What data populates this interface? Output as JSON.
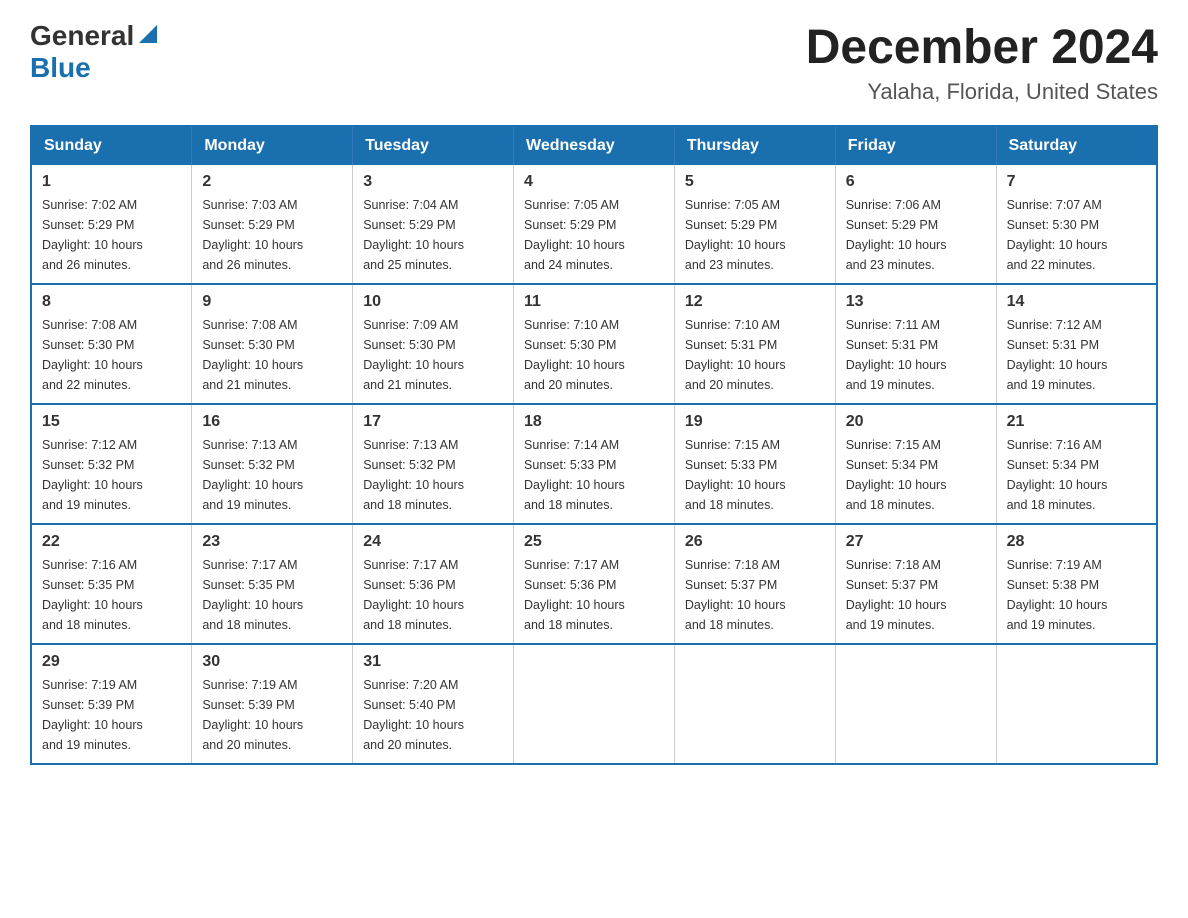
{
  "header": {
    "logo": {
      "general": "General",
      "blue": "Blue"
    },
    "month": "December 2024",
    "location": "Yalaha, Florida, United States"
  },
  "days_of_week": [
    "Sunday",
    "Monday",
    "Tuesday",
    "Wednesday",
    "Thursday",
    "Friday",
    "Saturday"
  ],
  "weeks": [
    [
      {
        "day": "1",
        "sunrise": "7:02 AM",
        "sunset": "5:29 PM",
        "daylight": "10 hours and 26 minutes."
      },
      {
        "day": "2",
        "sunrise": "7:03 AM",
        "sunset": "5:29 PM",
        "daylight": "10 hours and 26 minutes."
      },
      {
        "day": "3",
        "sunrise": "7:04 AM",
        "sunset": "5:29 PM",
        "daylight": "10 hours and 25 minutes."
      },
      {
        "day": "4",
        "sunrise": "7:05 AM",
        "sunset": "5:29 PM",
        "daylight": "10 hours and 24 minutes."
      },
      {
        "day": "5",
        "sunrise": "7:05 AM",
        "sunset": "5:29 PM",
        "daylight": "10 hours and 23 minutes."
      },
      {
        "day": "6",
        "sunrise": "7:06 AM",
        "sunset": "5:29 PM",
        "daylight": "10 hours and 23 minutes."
      },
      {
        "day": "7",
        "sunrise": "7:07 AM",
        "sunset": "5:30 PM",
        "daylight": "10 hours and 22 minutes."
      }
    ],
    [
      {
        "day": "8",
        "sunrise": "7:08 AM",
        "sunset": "5:30 PM",
        "daylight": "10 hours and 22 minutes."
      },
      {
        "day": "9",
        "sunrise": "7:08 AM",
        "sunset": "5:30 PM",
        "daylight": "10 hours and 21 minutes."
      },
      {
        "day": "10",
        "sunrise": "7:09 AM",
        "sunset": "5:30 PM",
        "daylight": "10 hours and 21 minutes."
      },
      {
        "day": "11",
        "sunrise": "7:10 AM",
        "sunset": "5:30 PM",
        "daylight": "10 hours and 20 minutes."
      },
      {
        "day": "12",
        "sunrise": "7:10 AM",
        "sunset": "5:31 PM",
        "daylight": "10 hours and 20 minutes."
      },
      {
        "day": "13",
        "sunrise": "7:11 AM",
        "sunset": "5:31 PM",
        "daylight": "10 hours and 19 minutes."
      },
      {
        "day": "14",
        "sunrise": "7:12 AM",
        "sunset": "5:31 PM",
        "daylight": "10 hours and 19 minutes."
      }
    ],
    [
      {
        "day": "15",
        "sunrise": "7:12 AM",
        "sunset": "5:32 PM",
        "daylight": "10 hours and 19 minutes."
      },
      {
        "day": "16",
        "sunrise": "7:13 AM",
        "sunset": "5:32 PM",
        "daylight": "10 hours and 19 minutes."
      },
      {
        "day": "17",
        "sunrise": "7:13 AM",
        "sunset": "5:32 PM",
        "daylight": "10 hours and 18 minutes."
      },
      {
        "day": "18",
        "sunrise": "7:14 AM",
        "sunset": "5:33 PM",
        "daylight": "10 hours and 18 minutes."
      },
      {
        "day": "19",
        "sunrise": "7:15 AM",
        "sunset": "5:33 PM",
        "daylight": "10 hours and 18 minutes."
      },
      {
        "day": "20",
        "sunrise": "7:15 AM",
        "sunset": "5:34 PM",
        "daylight": "10 hours and 18 minutes."
      },
      {
        "day": "21",
        "sunrise": "7:16 AM",
        "sunset": "5:34 PM",
        "daylight": "10 hours and 18 minutes."
      }
    ],
    [
      {
        "day": "22",
        "sunrise": "7:16 AM",
        "sunset": "5:35 PM",
        "daylight": "10 hours and 18 minutes."
      },
      {
        "day": "23",
        "sunrise": "7:17 AM",
        "sunset": "5:35 PM",
        "daylight": "10 hours and 18 minutes."
      },
      {
        "day": "24",
        "sunrise": "7:17 AM",
        "sunset": "5:36 PM",
        "daylight": "10 hours and 18 minutes."
      },
      {
        "day": "25",
        "sunrise": "7:17 AM",
        "sunset": "5:36 PM",
        "daylight": "10 hours and 18 minutes."
      },
      {
        "day": "26",
        "sunrise": "7:18 AM",
        "sunset": "5:37 PM",
        "daylight": "10 hours and 18 minutes."
      },
      {
        "day": "27",
        "sunrise": "7:18 AM",
        "sunset": "5:37 PM",
        "daylight": "10 hours and 19 minutes."
      },
      {
        "day": "28",
        "sunrise": "7:19 AM",
        "sunset": "5:38 PM",
        "daylight": "10 hours and 19 minutes."
      }
    ],
    [
      {
        "day": "29",
        "sunrise": "7:19 AM",
        "sunset": "5:39 PM",
        "daylight": "10 hours and 19 minutes."
      },
      {
        "day": "30",
        "sunrise": "7:19 AM",
        "sunset": "5:39 PM",
        "daylight": "10 hours and 20 minutes."
      },
      {
        "day": "31",
        "sunrise": "7:20 AM",
        "sunset": "5:40 PM",
        "daylight": "10 hours and 20 minutes."
      },
      null,
      null,
      null,
      null
    ]
  ],
  "labels": {
    "sunrise": "Sunrise:",
    "sunset": "Sunset:",
    "daylight": "Daylight:"
  }
}
